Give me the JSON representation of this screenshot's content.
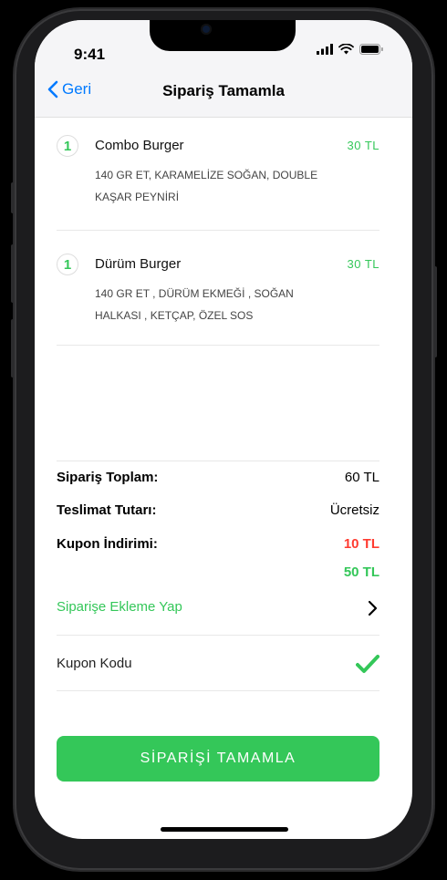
{
  "status": {
    "time": "9:41"
  },
  "nav": {
    "back_label": "Geri",
    "title": "Sipariş Tamamla"
  },
  "items": [
    {
      "qty": "1",
      "name": "Combo Burger",
      "price": "30 TL",
      "desc": "140 GR ET, KARAMELİZE SOĞAN, DOUBLE KAŞAR PEYNİRİ"
    },
    {
      "qty": "1",
      "name": "Dürüm Burger",
      "price": "30 TL",
      "desc": "140 GR ET , DÜRÜM EKMEĞİ , SOĞAN HALKASI , KETÇAP, ÖZEL SOS"
    }
  ],
  "summary": {
    "order_total_label": "Sipariş Toplam:",
    "order_total_value": "60 TL",
    "delivery_label": "Teslimat Tutarı:",
    "delivery_value": "Ücretsiz",
    "coupon_label": "Kupon İndirimi:",
    "coupon_value": "10 TL",
    "grand_total": "50 TL"
  },
  "actions": {
    "add_to_order": "Siparişe Ekleme Yap",
    "coupon_code": "Kupon Kodu",
    "complete": "SİPARİŞİ TAMAMLA"
  },
  "colors": {
    "accent_green": "#34c759",
    "discount_red": "#ff3b30",
    "link_blue": "#007aff"
  }
}
